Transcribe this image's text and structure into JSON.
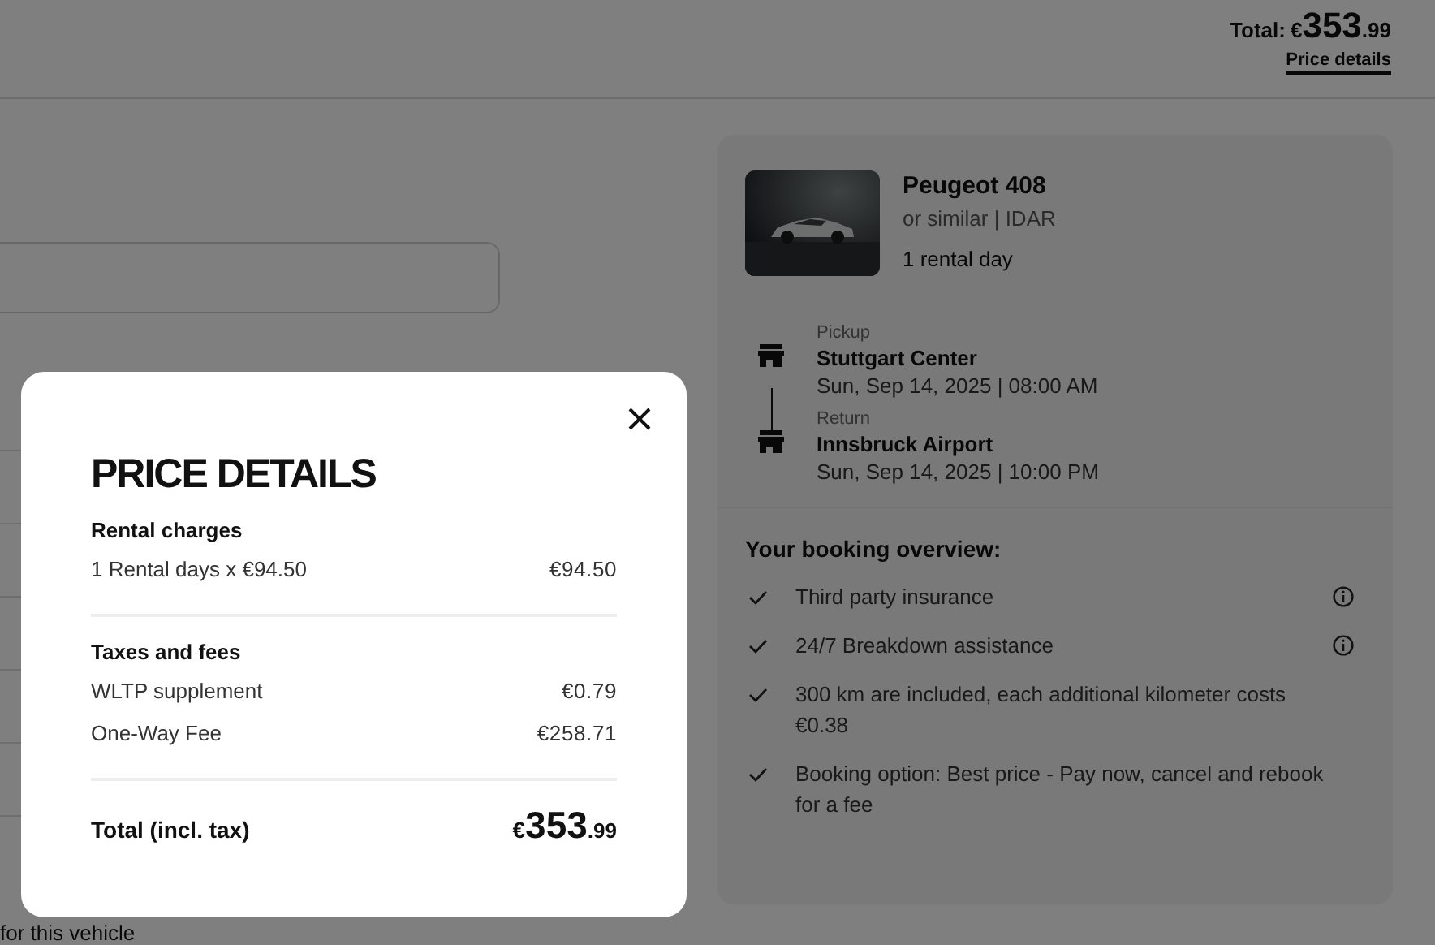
{
  "header": {
    "total_label": "Total:",
    "total_amount": {
      "currency": "€",
      "whole": "353",
      "fraction": ".99"
    },
    "price_details_link": "Price details"
  },
  "page_note": "for this vehicle",
  "booking_card": {
    "car": {
      "name": "Peugeot 408",
      "category": "or similar | IDAR",
      "rental_days": "1 rental day"
    },
    "pickup": {
      "label": "Pickup",
      "location": "Stuttgart Center",
      "datetime": "Sun, Sep 14, 2025 | 08:00 AM"
    },
    "return": {
      "label": "Return",
      "location": "Innsbruck Airport",
      "datetime": "Sun, Sep 14, 2025 | 10:00 PM"
    },
    "overview": {
      "title": "Your booking overview:",
      "items": [
        {
          "text": "Third party insurance",
          "info": true
        },
        {
          "text": "24/7 Breakdown assistance",
          "info": true
        },
        {
          "text": "300 km are included, each additional kilometer costs €0.38",
          "info": false
        },
        {
          "text": "Booking option: Best price - Pay now, cancel and rebook for a fee",
          "info": false
        }
      ]
    }
  },
  "modal": {
    "title": "PRICE DETAILS",
    "sections": [
      {
        "heading": "Rental charges",
        "rows": [
          {
            "label": "1 Rental days x €94.50",
            "amount": "€94.50"
          }
        ]
      },
      {
        "heading": "Taxes and fees",
        "rows": [
          {
            "label": "WLTP supplement",
            "amount": "€0.79"
          },
          {
            "label": "One-Way Fee",
            "amount": "€258.71"
          }
        ]
      }
    ],
    "total": {
      "label": "Total (incl. tax)",
      "amount": {
        "currency": "€",
        "whole": "353",
        "fraction": ".99"
      }
    }
  }
}
